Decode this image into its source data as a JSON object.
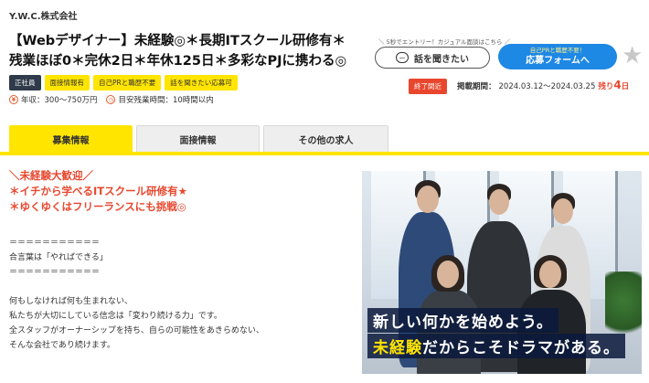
{
  "company": "Y.W.C.株式会社",
  "job_title_line1": "【Webデザイナー】未経験◎＊長期ITスクール研修有＊",
  "job_title_line2": "残業ほぼ0＊完休2日＊年休125日＊多彩なPJに携わる◎",
  "tags": [
    "正社員",
    "面接情報有",
    "自己PRと職歴不要",
    "話を聞きたい応募可"
  ],
  "salary": "年収：300〜750万円",
  "overtime": "目安残業時間：10時間以内",
  "cta": {
    "note": "＼ 5秒でエントリー！カジュアル面談はこちら ／",
    "talk_label": "話を聞きたい",
    "apply_sub": "自己PRと職歴不要！",
    "apply_main": "応募フォームへ"
  },
  "ending_badge": "終了間近",
  "period_label": "掲載期間：",
  "period_value": "2024.03.12〜2024.03.25",
  "remain_prefix": "残り",
  "remain_num": "4",
  "remain_unit": "日",
  "tabs": [
    "募集情報",
    "面接情報",
    "その他の求人"
  ],
  "catch": [
    "＼未経験大歓迎／",
    "＊イチから学べるITスクール研修有★",
    "＊ゆくゆくはフリーランスにも挑戦◎"
  ],
  "motto_border": "＝＝＝＝＝＝＝＝＝＝＝",
  "motto": "合言葉は「やればできる」",
  "body": [
    "何もしなければ何も生まれない、",
    "私たちが大切にしている信念は「変わり続ける力」です。",
    "全スタッフがオーナーシップを持ち、自らの可能性をあきらめない、",
    "そんな会社であり続けます。"
  ],
  "photo_caption1": "新しい何かを始めよう。",
  "photo_caption2_a": "未経験",
  "photo_caption2_b": "だからこそドラマがある。",
  "colors": {
    "accent_yellow": "#ffe500",
    "alert_red": "#e8472e",
    "apply_blue": "#1e88e5",
    "tag_dark": "#2f3a4a"
  },
  "icons": [
    "yen-icon",
    "clock-icon",
    "chat-icon",
    "star-icon"
  ]
}
